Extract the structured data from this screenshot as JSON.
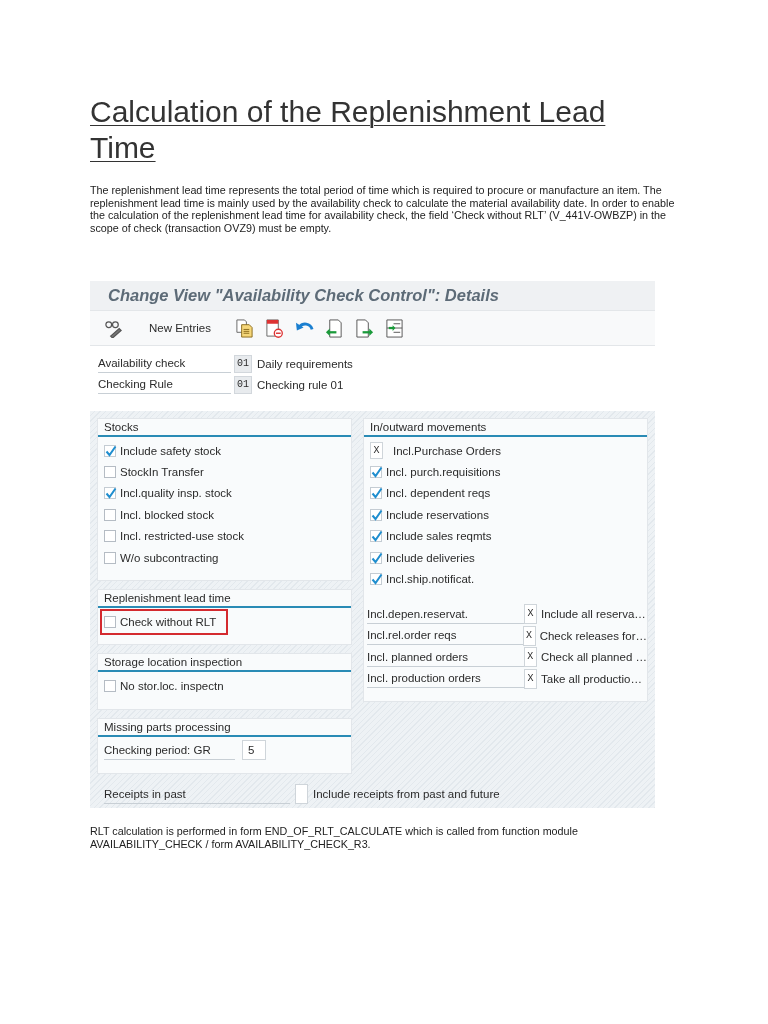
{
  "article": {
    "title": "Calculation of the Replenishment Lead Time",
    "intro": "The replenishment lead time represents the total period of time which is required to procure or manufacture an item. The replenishment lead time is mainly used by the availability check to calculate the material availability date. In order to enable the calculation of the replenishment lead time for availability check, the field ‘Check without RLT’ (V_441V-OWBZP) in the scope of check (transaction OVZ9) must be empty."
  },
  "sap_screen": {
    "title": "Change View \"Availability Check Control\": Details",
    "toolbar": {
      "new_entries": "New Entries"
    },
    "header_fields": [
      {
        "label": "Availability check",
        "value": "01",
        "description": "Daily requirements"
      },
      {
        "label": "Checking Rule",
        "value": "01",
        "description": "Checking rule 01"
      }
    ],
    "left_groups": [
      {
        "title": "Stocks",
        "items": [
          {
            "kind": "checkbox",
            "label": "Include safety stock",
            "checked": true,
            "highlighted": false
          },
          {
            "kind": "checkbox",
            "label": "StockIn Transfer",
            "checked": false,
            "highlighted": false
          },
          {
            "kind": "checkbox",
            "label": "Incl.quality insp. stock",
            "checked": true,
            "highlighted": false
          },
          {
            "kind": "checkbox",
            "label": "Incl. blocked stock",
            "checked": false,
            "highlighted": false
          },
          {
            "kind": "checkbox",
            "label": "Incl. restricted-use stock",
            "checked": false,
            "highlighted": false
          },
          {
            "kind": "checkbox",
            "label": "W/o subcontracting",
            "checked": false,
            "highlighted": false
          }
        ]
      },
      {
        "title": "Replenishment lead time",
        "items": [
          {
            "kind": "checkbox",
            "label": "Check without RLT",
            "checked": false,
            "highlighted": true
          }
        ]
      },
      {
        "title": "Storage location inspection",
        "items": [
          {
            "kind": "checkbox",
            "label": "No stor.loc. inspectn",
            "checked": false,
            "highlighted": false
          }
        ]
      },
      {
        "title": "Missing parts processing",
        "items": [
          {
            "kind": "input",
            "label": "Checking period: GR",
            "value": "5"
          }
        ]
      }
    ],
    "right_groups": [
      {
        "title": "In/outward movements",
        "items": [
          {
            "kind": "x_option",
            "label": "Incl.Purchase Orders",
            "value": "X"
          },
          {
            "kind": "checkbox",
            "label": "Incl. purch.requisitions",
            "checked": true,
            "highlighted": false
          },
          {
            "kind": "checkbox",
            "label": "Incl. dependent reqs",
            "checked": true,
            "highlighted": false
          },
          {
            "kind": "checkbox",
            "label": "Include reservations",
            "checked": true,
            "highlighted": false
          },
          {
            "kind": "checkbox",
            "label": "Include sales reqmts",
            "checked": true,
            "highlighted": false
          },
          {
            "kind": "checkbox",
            "label": "Include deliveries",
            "checked": true,
            "highlighted": false
          },
          {
            "kind": "checkbox",
            "label": "Incl.ship.notificat.",
            "checked": true,
            "highlighted": false
          },
          {
            "kind": "value_row",
            "label": "Incl.depen.reservat.",
            "value": "X",
            "description": "Include all reserva…"
          },
          {
            "kind": "value_row",
            "label": "Incl.rel.order reqs",
            "value": "X",
            "description": "Check releases for…"
          },
          {
            "kind": "value_row",
            "label": "Incl. planned orders",
            "value": "X",
            "description": "Check all planned …"
          },
          {
            "kind": "value_row",
            "label": "Incl. production orders",
            "value": "X",
            "description": "Take all productio…"
          }
        ]
      }
    ],
    "footer_row": {
      "label": "Receipts in past",
      "description": "Include receipts from past and future"
    }
  },
  "closing": "RLT calculation is performed in form END_OF_RLT_CALCULATE which is called from function module AVAILABILITY_CHECK / form AVAILABILITY_CHECK_R3."
}
